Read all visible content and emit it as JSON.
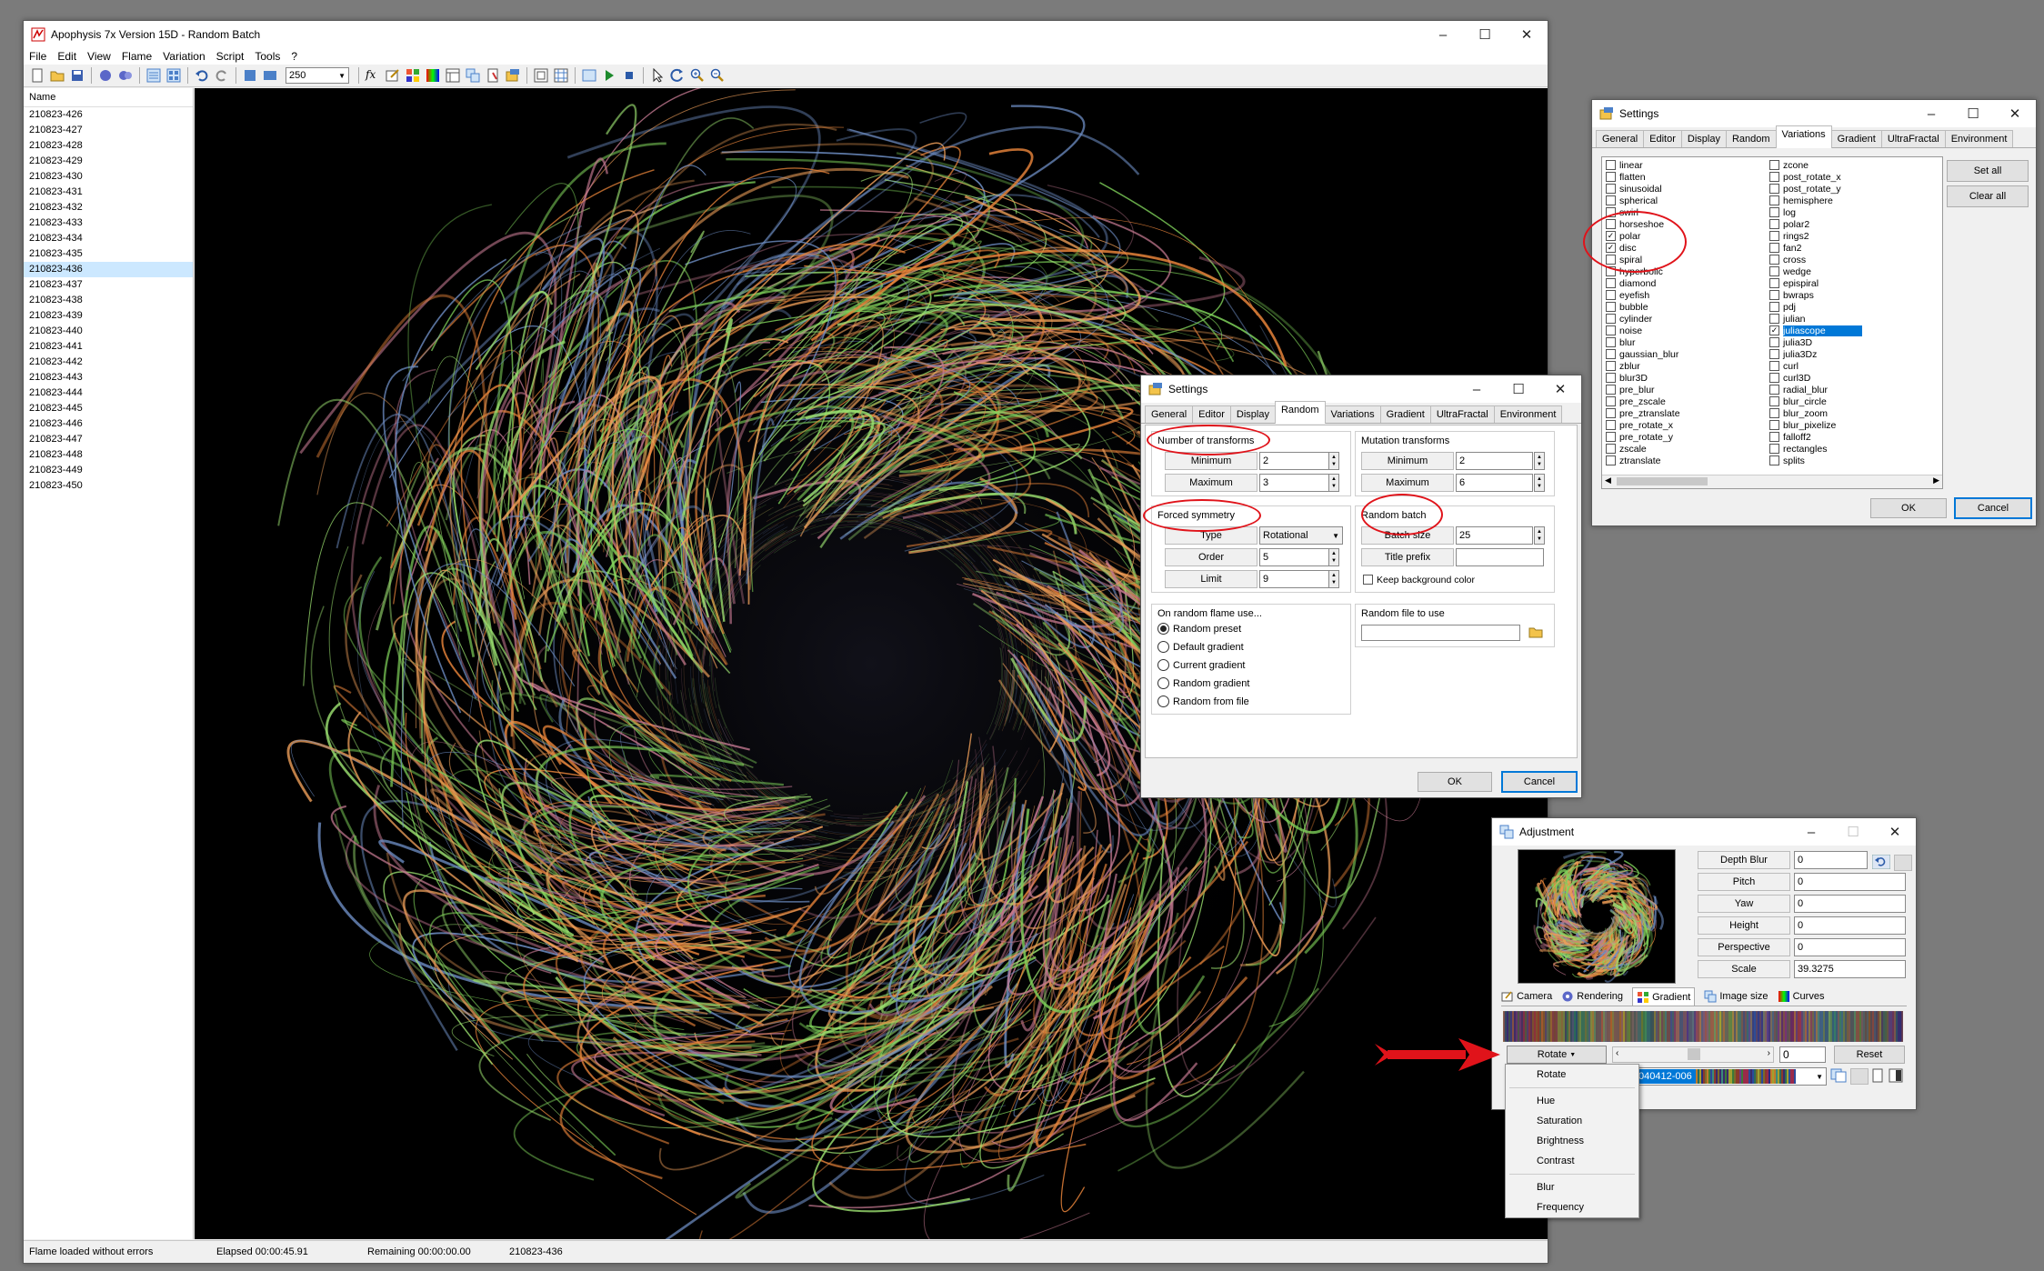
{
  "main": {
    "title": "Apophysis 7x Version 15D - Random Batch",
    "menu": [
      "File",
      "Edit",
      "View",
      "Flame",
      "Variation",
      "Script",
      "Tools",
      "?"
    ],
    "quality_value": "250",
    "list_header": "Name",
    "items": [
      "210823-426",
      "210823-427",
      "210823-428",
      "210823-429",
      "210823-430",
      "210823-431",
      "210823-432",
      "210823-433",
      "210823-434",
      "210823-435",
      "210823-436",
      "210823-437",
      "210823-438",
      "210823-439",
      "210823-440",
      "210823-441",
      "210823-442",
      "210823-443",
      "210823-444",
      "210823-445",
      "210823-446",
      "210823-447",
      "210823-448",
      "210823-449",
      "210823-450"
    ],
    "selected_index": 10,
    "status": {
      "message": "Flame loaded without errors",
      "elapsed": "Elapsed 00:00:45.91",
      "remaining": "Remaining 00:00:00.00",
      "current": "210823-436"
    }
  },
  "settings_random": {
    "title": "Settings",
    "tabs": [
      "General",
      "Editor",
      "Display",
      "Random",
      "Variations",
      "Gradient",
      "UltraFractal",
      "Environment"
    ],
    "active_tab": "Random",
    "num_transforms": {
      "label": "Number of transforms",
      "min_label": "Minimum",
      "min": "2",
      "max_label": "Maximum",
      "max": "3"
    },
    "mutation": {
      "label": "Mutation transforms",
      "min_label": "Minimum",
      "min": "2",
      "max_label": "Maximum",
      "max": "6"
    },
    "symmetry": {
      "label": "Forced symmetry",
      "type_label": "Type",
      "type": "Rotational",
      "order_label": "Order",
      "order": "5",
      "limit_label": "Limit",
      "limit": "9"
    },
    "batch": {
      "label": "Random batch",
      "size_label": "Batch size",
      "size": "25",
      "prefix_label": "Title prefix",
      "prefix": "",
      "keep_bg": "Keep background color"
    },
    "on_random": {
      "label": "On random flame use...",
      "options": [
        "Random preset",
        "Default gradient",
        "Current gradient",
        "Random gradient",
        "Random from file"
      ],
      "selected": 0
    },
    "random_file": {
      "label": "Random file to use",
      "value": ""
    },
    "ok": "OK",
    "cancel": "Cancel"
  },
  "settings_var": {
    "title": "Settings",
    "tabs": [
      "General",
      "Editor",
      "Display",
      "Random",
      "Variations",
      "Gradient",
      "UltraFractal",
      "Environment"
    ],
    "active_tab": "Variations",
    "col1": [
      {
        "n": "linear",
        "c": false
      },
      {
        "n": "flatten",
        "c": false
      },
      {
        "n": "sinusoidal",
        "c": false
      },
      {
        "n": "spherical",
        "c": false
      },
      {
        "n": "swirl",
        "c": false
      },
      {
        "n": "horseshoe",
        "c": false
      },
      {
        "n": "polar",
        "c": true
      },
      {
        "n": "disc",
        "c": true
      },
      {
        "n": "spiral",
        "c": false
      },
      {
        "n": "hyperbolic",
        "c": false
      },
      {
        "n": "diamond",
        "c": false
      },
      {
        "n": "eyefish",
        "c": false
      },
      {
        "n": "bubble",
        "c": false
      },
      {
        "n": "cylinder",
        "c": false
      },
      {
        "n": "noise",
        "c": false
      },
      {
        "n": "blur",
        "c": false
      },
      {
        "n": "gaussian_blur",
        "c": false
      },
      {
        "n": "zblur",
        "c": false
      },
      {
        "n": "blur3D",
        "c": false
      },
      {
        "n": "pre_blur",
        "c": false
      },
      {
        "n": "pre_zscale",
        "c": false
      },
      {
        "n": "pre_ztranslate",
        "c": false
      },
      {
        "n": "pre_rotate_x",
        "c": false
      },
      {
        "n": "pre_rotate_y",
        "c": false
      },
      {
        "n": "zscale",
        "c": false
      },
      {
        "n": "ztranslate",
        "c": false
      }
    ],
    "col2": [
      {
        "n": "zcone",
        "c": false
      },
      {
        "n": "post_rotate_x",
        "c": false
      },
      {
        "n": "post_rotate_y",
        "c": false
      },
      {
        "n": "hemisphere",
        "c": false
      },
      {
        "n": "log",
        "c": false
      },
      {
        "n": "polar2",
        "c": false
      },
      {
        "n": "rings2",
        "c": false
      },
      {
        "n": "fan2",
        "c": false
      },
      {
        "n": "cross",
        "c": false
      },
      {
        "n": "wedge",
        "c": false
      },
      {
        "n": "epispiral",
        "c": false
      },
      {
        "n": "bwraps",
        "c": false
      },
      {
        "n": "pdj",
        "c": false
      },
      {
        "n": "julian",
        "c": false
      },
      {
        "n": "juliascope",
        "c": true,
        "sel": true
      },
      {
        "n": "julia3D",
        "c": false
      },
      {
        "n": "julia3Dz",
        "c": false
      },
      {
        "n": "curl",
        "c": false
      },
      {
        "n": "curl3D",
        "c": false
      },
      {
        "n": "radial_blur",
        "c": false
      },
      {
        "n": "blur_circle",
        "c": false
      },
      {
        "n": "blur_zoom",
        "c": false
      },
      {
        "n": "blur_pixelize",
        "c": false
      },
      {
        "n": "falloff2",
        "c": false
      },
      {
        "n": "rectangles",
        "c": false
      },
      {
        "n": "splits",
        "c": false
      }
    ],
    "set_all": "Set all",
    "clear_all": "Clear all",
    "ok": "OK",
    "cancel": "Cancel"
  },
  "adjustment": {
    "title": "Adjustment",
    "fields": [
      {
        "label": "Depth Blur",
        "value": "0"
      },
      {
        "label": "Pitch",
        "value": "0"
      },
      {
        "label": "Yaw",
        "value": "0"
      },
      {
        "label": "Height",
        "value": "0"
      },
      {
        "label": "Perspective",
        "value": "0"
      },
      {
        "label": "Scale",
        "value": "39.3275"
      }
    ],
    "tabs": [
      "Camera",
      "Rendering",
      "Gradient",
      "Image size",
      "Curves"
    ],
    "active_tab": "Gradient",
    "rotate_label": "Rotate",
    "rotate_value": "0",
    "reset": "Reset",
    "gradient_name": "040412-006",
    "dropdown": [
      "Rotate",
      "Hue",
      "Saturation",
      "Brightness",
      "Contrast",
      "Blur",
      "Frequency"
    ]
  }
}
